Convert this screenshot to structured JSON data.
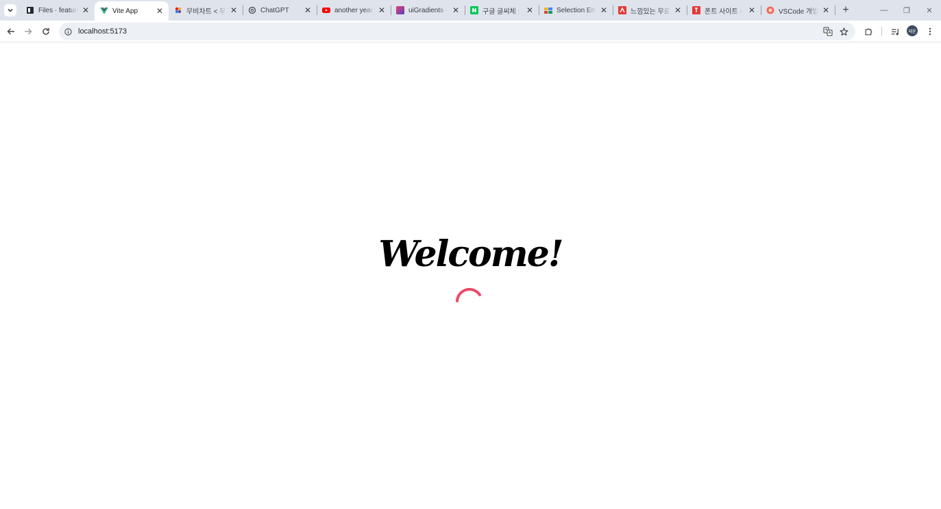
{
  "browser": {
    "tabs": [
      {
        "title": "Files · feature/",
        "icon": "github-icon",
        "active": false
      },
      {
        "title": "Vite App",
        "icon": "vue-icon",
        "active": true
      },
      {
        "title": "무비차트 < 무",
        "icon": "cgv-icon",
        "active": false
      },
      {
        "title": "ChatGPT",
        "icon": "chatgpt-icon",
        "active": false
      },
      {
        "title": "another year a",
        "icon": "youtube-icon",
        "active": false
      },
      {
        "title": "uiGradients - E",
        "icon": "uigradients-icon",
        "active": false
      },
      {
        "title": "구글 글씨체 : G",
        "icon": "naver-icon",
        "active": false
      },
      {
        "title": "Selection Emb",
        "icon": "selection-icon",
        "active": false
      },
      {
        "title": "느낌있는 무료",
        "icon": "red-square-icon",
        "active": false
      },
      {
        "title": "폰트 사이트 -",
        "icon": "red-square-icon-2",
        "active": false
      },
      {
        "title": "VSCode 개발용",
        "icon": "red-circle-icon",
        "active": false
      }
    ],
    "close_glyph": "✕",
    "new_tab_glyph": "+",
    "window_controls": {
      "minimize": "—",
      "restore": "❐",
      "close": "✕"
    },
    "address": {
      "url": "localhost:5173"
    },
    "profile_initials": "태윤"
  },
  "page": {
    "heading": "Welcome!",
    "spinner_color": "#ee4868"
  }
}
